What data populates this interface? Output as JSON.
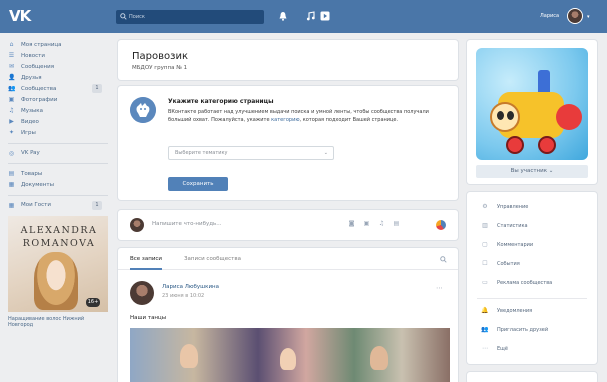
{
  "header": {
    "logo": "VK",
    "search_placeholder": "Поиск",
    "user_name": "Лариса"
  },
  "sidebar": {
    "items": [
      {
        "icon": "home-icon",
        "glyph": "⌂",
        "label": "Моя страница"
      },
      {
        "icon": "news-icon",
        "glyph": "☰",
        "label": "Новости"
      },
      {
        "icon": "messages-icon",
        "glyph": "✉",
        "label": "Сообщения"
      },
      {
        "icon": "friends-icon",
        "glyph": "👤",
        "label": "Друзья"
      },
      {
        "icon": "communities-icon",
        "glyph": "👥",
        "label": "Сообщества",
        "badge": "1"
      },
      {
        "icon": "photos-icon",
        "glyph": "▣",
        "label": "Фотографии"
      },
      {
        "icon": "music-icon",
        "glyph": "♫",
        "label": "Музыка"
      },
      {
        "icon": "video-icon",
        "glyph": "▶",
        "label": "Видео"
      },
      {
        "icon": "games-icon",
        "glyph": "✦",
        "label": "Игры"
      }
    ],
    "vkpay": {
      "icon": "vkpay-icon",
      "glyph": "◎",
      "label": "VK Pay"
    },
    "extra": [
      {
        "icon": "goods-icon",
        "glyph": "▤",
        "label": "Товары"
      },
      {
        "icon": "documents-icon",
        "glyph": "▦",
        "label": "Документы"
      }
    ],
    "ads_header": {
      "label": "Мои Гости",
      "badge": "1"
    },
    "ad": {
      "line1": "ALEXANDRA",
      "line2": "ROMANOVA",
      "age": "16+",
      "caption": "Наращивание волос Нижний Новгород"
    }
  },
  "main": {
    "title": "Паровозик",
    "subtitle": "МБДОУ группа № 1",
    "category_card": {
      "title": "Укажите категорию страницы",
      "desc_before": "ВКонтакте работает над улучшением выдачи поиска и умной ленты, чтобы сообщества получали больший охват. Пожалуйста, укажите ",
      "desc_link": "категорию",
      "desc_after": ", которая подходит Вашей странице.",
      "select_value": "Выберите тематику",
      "button": "Сохранить"
    },
    "composer": {
      "placeholder": "Напишите что-нибудь..."
    },
    "feed": {
      "tabs": [
        "Все записи",
        "Записи сообщества"
      ],
      "post": {
        "author": "Лариса Любушкина",
        "date": "23 июня в 10:02",
        "text": "Наши танцы"
      }
    }
  },
  "right": {
    "member_button": "Вы участник ⌄",
    "menu": [
      {
        "icon": "settings-icon",
        "glyph": "⚙",
        "label": "Управление"
      },
      {
        "icon": "stats-icon",
        "glyph": "▥",
        "label": "Статистика"
      },
      {
        "icon": "comments-icon",
        "glyph": "▢",
        "label": "Комментарии"
      },
      {
        "icon": "events-icon",
        "glyph": "☐",
        "label": "События"
      },
      {
        "icon": "ads-icon",
        "glyph": "▭",
        "label": "Реклама сообщества"
      }
    ],
    "menu2": [
      {
        "icon": "notify-icon",
        "glyph": "🔔",
        "label": "Уведомления"
      },
      {
        "icon": "invite-icon",
        "glyph": "👥",
        "label": "Пригласить друзей"
      },
      {
        "icon": "more-icon",
        "glyph": "⋯",
        "label": "Ещё"
      }
    ]
  },
  "colors": {
    "header": "#4a76a8",
    "accent": "#5181b8",
    "link": "#2a5885"
  }
}
